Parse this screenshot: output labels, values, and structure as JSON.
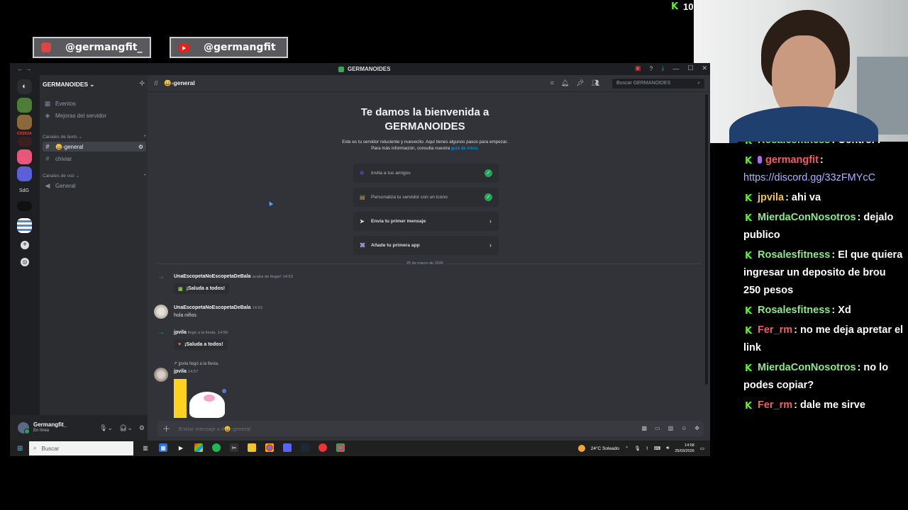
{
  "overlay": {
    "instagram_handle": "@germangfit_",
    "youtube_handle": "@germangfit",
    "viewer_count": "10",
    "viewer_icon": "kick-logo-icon"
  },
  "chat": {
    "messages": [
      {
        "user": "Rosalesfitness",
        "user_color": "#8ee88b",
        "text": ": Control f"
      },
      {
        "user": "germangfit",
        "user_color": "#f45f5f",
        "text": ":",
        "link": "https://discord.gg/33zFMYcC"
      },
      {
        "user": "jpvila",
        "user_color": "#f5c14a",
        "text": ": ahi va"
      },
      {
        "user": "MierdaConNosotros",
        "user_color": "#8ee88b",
        "text": ": dejalo publico"
      },
      {
        "user": "Rosalesfitness",
        "user_color": "#8ee88b",
        "text": ": El que quiera ingresar un deposito de brou 250 pesos"
      },
      {
        "user": "Rosalesfitness",
        "user_color": "#8ee88b",
        "text": ": Xd"
      },
      {
        "user": "Fer_rm",
        "user_color": "#f45f5f",
        "text": ": no me deja apretar el link"
      },
      {
        "user": "MierdaConNosotros",
        "user_color": "#8ee88b",
        "text": ": no lo podes copiar?"
      },
      {
        "user": "Fer_rm",
        "user_color": "#f45f5f",
        "text": ": dale me sirve"
      }
    ]
  },
  "discord": {
    "window_title": "GERMANOIDES",
    "server_name": "GERMANOIDES",
    "sidebar": {
      "events": "Eventos",
      "boosts": "Mejoras del servidor",
      "text_category": "Canales de texto",
      "text_channels": [
        "😀-general",
        "chiviar"
      ],
      "voice_category": "Canales de voz",
      "voice_channels": [
        "General"
      ]
    },
    "guild_labels": {
      "cozicia": "COZICIA",
      "sdg": "SdG"
    },
    "user": {
      "name": "Germangfit_",
      "status": "En línea"
    },
    "header": {
      "channel": "😀-general",
      "search_placeholder": "Buscar GERMANOIDES"
    },
    "welcome": {
      "title": "Te damos la bienvenida a GERMANOIDES",
      "subtitle": "Este es tu servidor reluciente y nuevecito. Aquí tienes algunos pasos para empezar. Para más información, consulta nuestra",
      "subtitle_link": "guía de inicio",
      "tasks": [
        {
          "label": "Invita a tus amigos",
          "done": true
        },
        {
          "label": "Personaliza tu servidor con un icono",
          "done": true
        },
        {
          "label": "Envía tu primer mensaje",
          "done": false
        },
        {
          "label": "Añade tu primera app",
          "done": false
        }
      ]
    },
    "date_separator": "25 de marzo de 2026",
    "messages": {
      "m1_name": "UnaEscopetaNoEscopetaDeBala",
      "m1_meta": "acaba de llegar! 14:53",
      "wave": "¡Saluda a todos!",
      "m2_name": "UnaEscopetaNoEscopetaDeBala",
      "m2_time": "14:53",
      "m2_text": "hola niños",
      "m3_name": "jpvila",
      "m3_meta": "llegó a la fiesta. 14:56",
      "m4_reply": "jpvila llegó a la fiesta.",
      "m4_name": "jpvila",
      "m4_time": "14:57"
    },
    "composer_placeholder": "Enviar mensaje a #😀-general"
  },
  "taskbar": {
    "search": "Buscar",
    "weather": "24°C  Soleado",
    "time": "14:58",
    "date": "25/03/2026"
  }
}
